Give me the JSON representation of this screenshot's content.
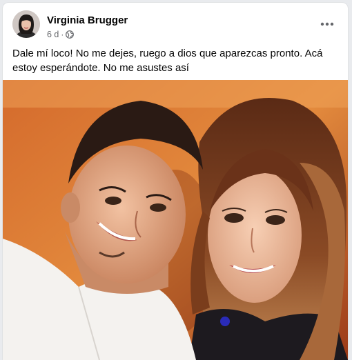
{
  "post": {
    "author_name": "Virginia Brugger",
    "time_ago": "6 d",
    "separator": "·",
    "audience_icon": "globe-icon",
    "more_icon": "more-options-icon",
    "text": "Dale mí loco! No me dejes, ruego a dios que aparezcas pronto. Acá estoy esperándote. No me asustes así"
  },
  "colors": {
    "author_text": "#050505",
    "meta_text": "#65676b",
    "card_bg": "#ffffff",
    "page_bg": "#e9ebee"
  }
}
